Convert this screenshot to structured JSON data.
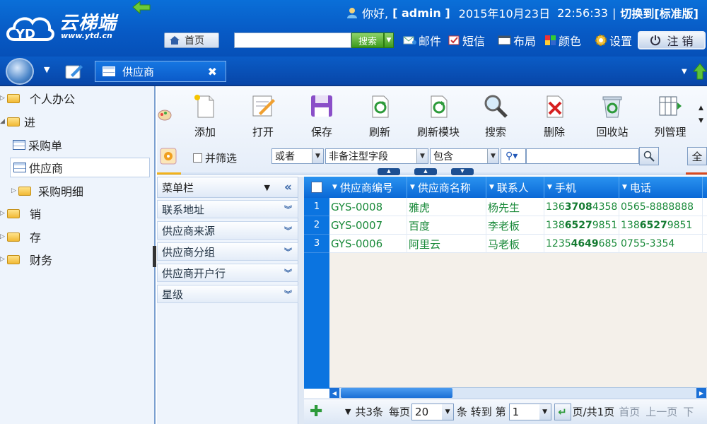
{
  "header": {
    "logo_text": "云梯端",
    "logo_url": "www.ytd.cn",
    "greeting": "你好,",
    "user": "[ admin ]",
    "date": "2015年10月23日",
    "time": "22:56:33",
    "separator": "|",
    "switch_label": "切换到[标准版]",
    "home_label": "首页",
    "search_placeholder": "",
    "search_label": "搜索",
    "links": [
      "邮件",
      "短信",
      "布局",
      "颜色",
      "设置"
    ],
    "logout_label": "注 销"
  },
  "tabs": {
    "active_label": "供应商",
    "close": "✖"
  },
  "sidebar": {
    "items": [
      {
        "label": "个人办公"
      },
      {
        "label": "进"
      },
      {
        "label": "采购单"
      },
      {
        "label": "供应商"
      },
      {
        "label": "采购明细"
      },
      {
        "label": "销"
      },
      {
        "label": "存"
      },
      {
        "label": "财务"
      }
    ]
  },
  "toolbar": {
    "tools": [
      "添加",
      "打开",
      "保存",
      "刷新",
      "刷新模块",
      "搜索",
      "删除",
      "回收站",
      "列管理"
    ],
    "filter_checkbox_label": "并筛选",
    "logic_select": "或者",
    "field_select": "非备注型字段",
    "op_select": "包含",
    "all_label": "全"
  },
  "menu_panel": {
    "title": "菜单栏",
    "collapse": "«",
    "items": [
      "联系地址",
      "供应商来源",
      "供应商分组",
      "供应商开户行",
      "星级"
    ]
  },
  "grid": {
    "columns": [
      "供应商编号",
      "供应商名称",
      "联系人",
      "手机",
      "电话"
    ],
    "rows": [
      {
        "num": "1",
        "code": "GYS-0008",
        "name": "雅虎",
        "contact": "杨先生",
        "mobile_a": "136 ",
        "mobile_b": "3708",
        "mobile_c": " 4358",
        "phone": "0565-8888888"
      },
      {
        "num": "2",
        "code": "GYS-0007",
        "name": "百度",
        "contact": "李老板",
        "mobile_a": "138 ",
        "mobile_b": "6527",
        "mobile_c": " 9851",
        "phone_a": "138 ",
        "phone_b": "6527",
        "phone_c": " 9851"
      },
      {
        "num": "3",
        "code": "GYS-0006",
        "name": "阿里云",
        "contact": "马老板",
        "mobile_a": "1235 ",
        "mobile_b": "4649",
        "mobile_c": " 685",
        "phone": "0755-3354"
      }
    ]
  },
  "pager": {
    "total": "共3条",
    "per_page_label": "每页",
    "per_page": "20",
    "goto_label": "条 转到 第",
    "page": "1",
    "page_of": "页/共1页",
    "first": "首页",
    "prev": "上一页",
    "next": "下"
  },
  "colors": {
    "header_blue": "#0759c4",
    "grid_blue": "#0a68d6",
    "cell_green": "#1a8a3a"
  }
}
